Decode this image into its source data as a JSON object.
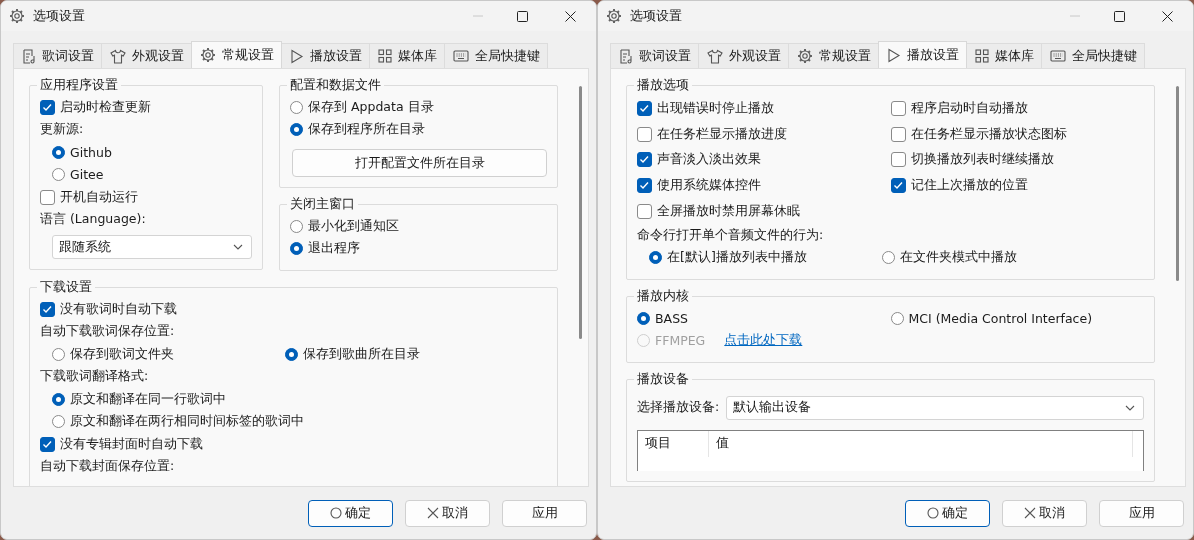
{
  "windows": [
    {
      "title": "选项设置",
      "tabs": [
        {
          "label": "歌词设置",
          "selected": false
        },
        {
          "label": "外观设置",
          "selected": false
        },
        {
          "label": "常规设置",
          "selected": true
        },
        {
          "label": "播放设置",
          "selected": false
        },
        {
          "label": "媒体库",
          "selected": false
        },
        {
          "label": "全局快捷键",
          "selected": false
        }
      ],
      "rows": [
        [
          [
            {
              "title": "应用程序设置",
              "items": [
                {
                  "kind": "checkbox",
                  "label": "启动时检查更新",
                  "checked": true,
                  "disabled": false
                },
                {
                  "kind": "label",
                  "text": "更新源:"
                },
                {
                  "kind": "options",
                  "indented": true,
                  "inline": false,
                  "options": [
                    {
                      "label": "Github",
                      "selected": true,
                      "disabled": false
                    },
                    {
                      "label": "Gitee",
                      "selected": false,
                      "disabled": false
                    }
                  ]
                },
                {
                  "kind": "checkbox",
                  "label": "开机自动运行",
                  "checked": false,
                  "disabled": false
                },
                {
                  "kind": "label",
                  "text": "语言 (Language):"
                },
                {
                  "kind": "select",
                  "value": "跟随系统"
                }
              ]
            }
          ],
          [
            {
              "title": "配置和数据文件",
              "items": [
                {
                  "kind": "options",
                  "indented": false,
                  "inline": false,
                  "options": [
                    {
                      "label": "保存到 Appdata 目录",
                      "selected": false,
                      "disabled": false
                    },
                    {
                      "label": "保存到程序所在目录",
                      "selected": true,
                      "disabled": false
                    }
                  ]
                },
                {
                  "kind": "button",
                  "label": "打开配置文件所在目录"
                }
              ]
            },
            {
              "title": "关闭主窗口",
              "items": [
                {
                  "kind": "options",
                  "indented": false,
                  "inline": false,
                  "options": [
                    {
                      "label": "最小化到通知区",
                      "selected": false,
                      "disabled": false
                    },
                    {
                      "label": "退出程序",
                      "selected": true,
                      "disabled": false
                    }
                  ]
                }
              ]
            }
          ]
        ],
        [
          [
            {
              "title": "下载设置",
              "items": [
                {
                  "kind": "checkbox",
                  "label": "没有歌词时自动下载",
                  "checked": true,
                  "disabled": false
                },
                {
                  "kind": "label",
                  "text": "自动下载歌词保存位置:"
                },
                {
                  "kind": "options",
                  "indented": true,
                  "inline": true,
                  "options": [
                    {
                      "label": "保存到歌词文件夹",
                      "selected": false,
                      "disabled": false
                    },
                    {
                      "label": "保存到歌曲所在目录",
                      "selected": true,
                      "disabled": false
                    }
                  ]
                },
                {
                  "kind": "label",
                  "text": "下载歌词翻译格式:"
                },
                {
                  "kind": "options",
                  "indented": true,
                  "inline": false,
                  "options": [
                    {
                      "label": "原文和翻译在同一行歌词中",
                      "selected": true,
                      "disabled": false
                    },
                    {
                      "label": "原文和翻译在两行相同时间标签的歌词中",
                      "selected": false,
                      "disabled": false
                    }
                  ]
                },
                {
                  "kind": "checkbox",
                  "label": "没有专辑封面时自动下载",
                  "checked": true,
                  "disabled": false
                },
                {
                  "kind": "label",
                  "text": "自动下载封面保存位置:"
                }
              ]
            }
          ]
        ]
      ],
      "buttons": [
        {
          "label": "确定",
          "default": true
        },
        {
          "label": "取消",
          "default": false
        },
        {
          "label": "应用",
          "default": false
        }
      ]
    },
    {
      "title": "选项设置",
      "tabs": [
        {
          "label": "歌词设置",
          "selected": false
        },
        {
          "label": "外观设置",
          "selected": false
        },
        {
          "label": "常规设置",
          "selected": false
        },
        {
          "label": "播放设置",
          "selected": true
        },
        {
          "label": "媒体库",
          "selected": false
        },
        {
          "label": "全局快捷键",
          "selected": false
        }
      ],
      "rows": [
        [
          [
            {
              "title": "播放选项",
              "items": [
                {
                  "kind": "checkgrid",
                  "items": [
                    {
                      "label": "出现错误时停止播放",
                      "checked": true,
                      "disabled": false
                    },
                    {
                      "label": "程序启动时自动播放",
                      "checked": false,
                      "disabled": false
                    },
                    {
                      "label": "在任务栏显示播放进度",
                      "checked": false,
                      "disabled": false
                    },
                    {
                      "label": "在任务栏显示播放状态图标",
                      "checked": false,
                      "disabled": false
                    },
                    {
                      "label": "声音淡入淡出效果",
                      "checked": true,
                      "disabled": false
                    },
                    {
                      "label": "切换播放列表时继续播放",
                      "checked": false,
                      "disabled": false
                    },
                    {
                      "label": "使用系统媒体控件",
                      "checked": true,
                      "disabled": false
                    },
                    {
                      "label": "记住上次播放的位置",
                      "checked": true,
                      "disabled": false
                    },
                    {
                      "label": "全屏播放时禁用屏幕休眠",
                      "checked": false,
                      "disabled": false
                    }
                  ]
                },
                {
                  "kind": "label",
                  "text": "命令行打开单个音频文件的行为:"
                },
                {
                  "kind": "options",
                  "indented": true,
                  "inline": true,
                  "options": [
                    {
                      "label": "在[默认]播放列表中播放",
                      "selected": true,
                      "disabled": false
                    },
                    {
                      "label": "在文件夹模式中播放",
                      "selected": false,
                      "disabled": false
                    }
                  ]
                }
              ]
            }
          ]
        ],
        [
          [
            {
              "title": "播放内核",
              "items": [
                {
                  "kind": "options",
                  "indented": false,
                  "inline": true,
                  "options": [
                    {
                      "label": "BASS",
                      "selected": true,
                      "disabled": false
                    },
                    {
                      "label": "MCI (Media Control Interface)",
                      "selected": false,
                      "disabled": false
                    },
                    {
                      "label": "FFMPEG",
                      "selected": false,
                      "disabled": true,
                      "link": "点击此处下载"
                    }
                  ]
                }
              ]
            }
          ]
        ],
        [
          [
            {
              "title": "播放设备",
              "items": [
                {
                  "kind": "select-row",
                  "label": "选择播放设备:",
                  "value": "默认输出设备"
                },
                {
                  "kind": "table",
                  "columns": [
                    "项目",
                    "值"
                  ]
                }
              ]
            }
          ]
        ]
      ],
      "buttons": [
        {
          "label": "确定",
          "default": true
        },
        {
          "label": "取消",
          "default": false
        },
        {
          "label": "应用",
          "default": false
        }
      ]
    }
  ]
}
